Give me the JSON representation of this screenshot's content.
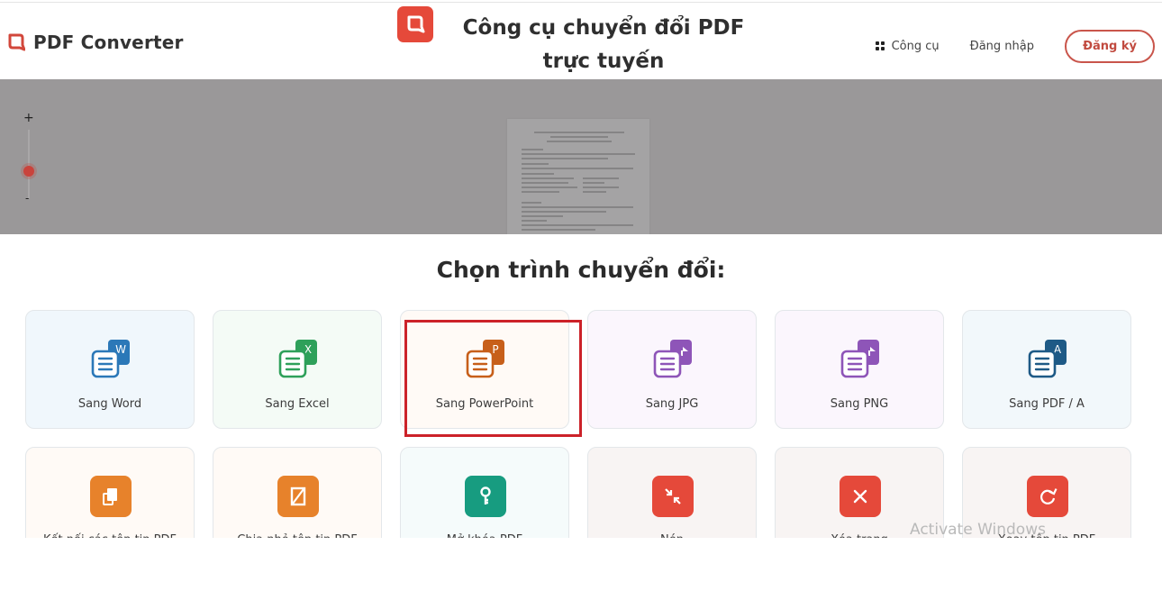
{
  "header": {
    "brand_name": "PDF Converter",
    "hero_title": "Công cụ chuyển đổi PDF trực tuyến",
    "nav": {
      "tools_label": "Công cụ",
      "login_label": "Đăng nhập",
      "signup_label": "Đăng ký"
    }
  },
  "preview": {
    "zoom_in_label": "+",
    "zoom_out_label": "-",
    "zoom_level_fraction": 0.35
  },
  "main": {
    "section_title": "Chọn trình chuyển đổi:",
    "converters": [
      {
        "label": "Sang Word",
        "icon": "word-icon",
        "badge_letter": "W",
        "accent": "#2b78b8",
        "bg": "#f0f7fc"
      },
      {
        "label": "Sang Excel",
        "icon": "excel-icon",
        "badge_letter": "X",
        "accent": "#2ea05a",
        "bg": "#f4fbf6"
      },
      {
        "label": "Sang PowerPoint",
        "icon": "powerpoint-icon",
        "badge_letter": "P",
        "accent": "#c75f1a",
        "bg": "#fffaf6"
      },
      {
        "label": "Sang JPG",
        "icon": "jpg-icon",
        "badge_letter": "",
        "accent": "#8e55b8",
        "bg": "#fbf6fd"
      },
      {
        "label": "Sang PNG",
        "icon": "png-icon",
        "badge_letter": "",
        "accent": "#8e55b8",
        "bg": "#fbf6fd"
      },
      {
        "label": "Sang PDF / A",
        "icon": "pdfa-icon",
        "badge_letter": "A",
        "accent": "#1e5a86",
        "bg": "#f2f8fb"
      }
    ],
    "tools": [
      {
        "label": "Kết nối các tệp tin PDF",
        "icon": "merge-icon",
        "accent": "#e7822b",
        "bg": "#fffaf6"
      },
      {
        "label": "Chia nhỏ tệp tin PDF",
        "icon": "split-icon",
        "accent": "#e7822b",
        "bg": "#fffaf6"
      },
      {
        "label": "Mở khóa PDF",
        "icon": "key-icon",
        "accent": "#179c80",
        "bg": "#f5fbfb"
      },
      {
        "label": "Nén",
        "icon": "compress-icon",
        "accent": "#e5493a",
        "bg": "#f8f4f3"
      },
      {
        "label": "Xóa trang",
        "icon": "close-icon",
        "accent": "#e5493a",
        "bg": "#f8f4f3"
      },
      {
        "label": "Xoay tệp tin PDF",
        "icon": "rotate-icon",
        "accent": "#e5493a",
        "bg": "#f8f4f3"
      }
    ],
    "highlighted": "Sang PowerPoint"
  },
  "overlay": {
    "watermark": "Activate Windows"
  }
}
